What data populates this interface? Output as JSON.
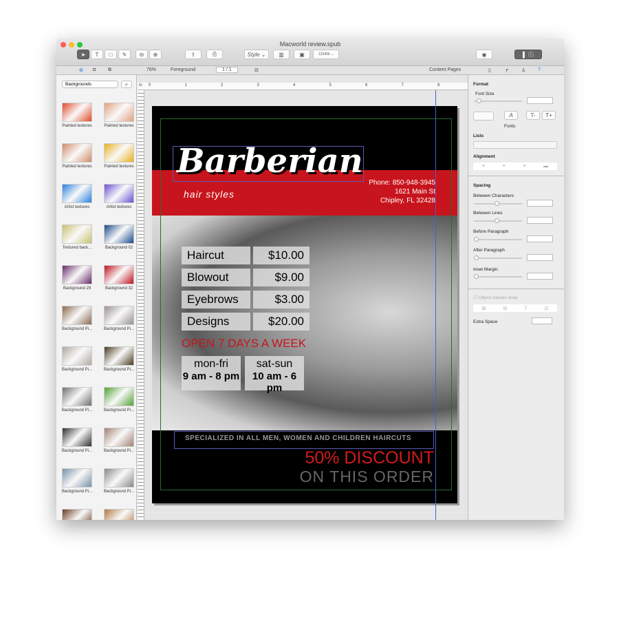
{
  "window": {
    "title": "Macworld review.spub"
  },
  "toolbar": {
    "style_label": "Style",
    "zoom": "76%",
    "layer": "Foreground",
    "page": "1 / 1",
    "content_pages": "Content Pages",
    "barcode_label": "123456"
  },
  "sidebar": {
    "category": "Backgrounds",
    "items": [
      {
        "label": "Painted textures",
        "color": "#e04a2a"
      },
      {
        "label": "Painted textures",
        "color": "#e0a080"
      },
      {
        "label": "Painted textures",
        "color": "#d08a6a"
      },
      {
        "label": "Painted textures",
        "color": "#e8b020"
      },
      {
        "label": "Artist textures",
        "color": "#2a80e0"
      },
      {
        "label": "Artist textures",
        "color": "#6a50d0"
      },
      {
        "label": "Textured back...",
        "color": "#c8c070"
      },
      {
        "label": "Background 02",
        "color": "#1a4a8a"
      },
      {
        "label": "Background 29",
        "color": "#6a2a6a"
      },
      {
        "label": "Background 32",
        "color": "#c01020"
      },
      {
        "label": "Background Pi...",
        "color": "#8a6a50"
      },
      {
        "label": "Background Pi...",
        "color": "#9a9090"
      },
      {
        "label": "Background Pi...",
        "color": "#b0a8a0"
      },
      {
        "label": "Background Pi...",
        "color": "#4a3a20"
      },
      {
        "label": "Background Pi...",
        "color": "#707070"
      },
      {
        "label": "Background Pi...",
        "color": "#50a030"
      },
      {
        "label": "Background Pi...",
        "color": "#303030"
      },
      {
        "label": "Background Pi...",
        "color": "#a08070"
      },
      {
        "label": "Background Pi...",
        "color": "#7890a8"
      },
      {
        "label": "Background Pi...",
        "color": "#888888"
      },
      {
        "label": "",
        "color": "#6a3a20"
      },
      {
        "label": "",
        "color": "#b07a40"
      }
    ]
  },
  "ruler": {
    "unit": "in",
    "ticks": [
      "0",
      "1",
      "2",
      "3",
      "4",
      "5",
      "6",
      "7",
      "8"
    ]
  },
  "poster": {
    "brand": "Barberian",
    "tagline": "hair styles",
    "phone": "Phone: 850-948-3945",
    "street": "1621 Main St",
    "city": "Chipley, FL 32428",
    "prices": [
      {
        "service": "Haircut",
        "price": "$10.00"
      },
      {
        "service": "Blowout",
        "price": "$9.00"
      },
      {
        "service": "Eyebrows",
        "price": "$3.00"
      },
      {
        "service": "Designs",
        "price": "$20.00"
      }
    ],
    "open": "OPEN 7 DAYS A WEEK",
    "hours": [
      {
        "days": "mon-fri",
        "time": "9 am - 8 pm"
      },
      {
        "days": "sat-sun",
        "time": "10 am - 6 pm"
      }
    ],
    "specialized": "SPECIALIZED IN ALL MEN, WOMEN AND CHILDREN HAIRCUTS",
    "discount": "50% DISCOUNT",
    "order": "ON THIS ORDER"
  },
  "inspector": {
    "format": "Format",
    "font_size": "Font Size",
    "fonts": "Fonts",
    "lists": "Lists",
    "alignment": "Alignment",
    "spacing": "Spacing",
    "between_chars": "Between Characters",
    "between_lines": "Between Lines",
    "before_par": "Before Paragraph",
    "after_par": "After Paragraph",
    "inset": "Inset Margin",
    "wrap": "Object causes wrap",
    "extra": "Extra Space"
  }
}
